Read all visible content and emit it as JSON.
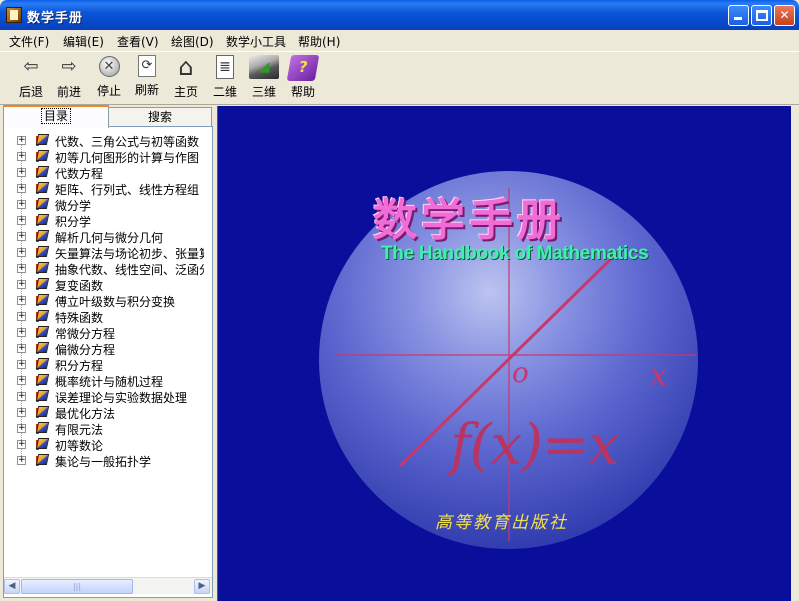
{
  "window": {
    "title": "数学手册",
    "buttons": {
      "minimize": "_",
      "maximize": "□",
      "close": "✕"
    }
  },
  "menu": [
    "文件(F)",
    "编辑(E)",
    "查看(V)",
    "绘图(D)",
    "数学小工具",
    "帮助(H)"
  ],
  "toolbar": [
    {
      "label": "后退",
      "icon": "arrow-left-icon",
      "glyph": "⇦"
    },
    {
      "label": "前进",
      "icon": "arrow-right-icon",
      "glyph": "⇨"
    },
    {
      "label": "停止",
      "icon": "stop-icon",
      "glyph": "✕"
    },
    {
      "label": "刷新",
      "icon": "refresh-icon",
      "glyph": "⟳"
    },
    {
      "label": "主页",
      "icon": "home-icon",
      "glyph": "⌂"
    },
    {
      "label": "二维",
      "icon": "2d-plot-icon",
      "glyph": "≣"
    },
    {
      "label": "三维",
      "icon": "3d-plot-icon",
      "glyph": "◢"
    },
    {
      "label": "帮助",
      "icon": "help-book-icon",
      "glyph": "?"
    }
  ],
  "tabs": [
    "目录",
    "搜索"
  ],
  "tree": [
    "代数、三角公式与初等函数",
    "初等几何图形的计算与作图",
    "代数方程",
    "矩阵、行列式、线性方程组",
    "微分学",
    "积分学",
    "解析几何与微分几何",
    "矢量算法与场论初步、张量算法",
    "抽象代数、线性空间、泛函分析",
    "复变函数",
    "傅立叶级数与积分变换",
    "特殊函数",
    "常微分方程",
    "偏微分方程",
    "积分方程",
    "概率统计与随机过程",
    "误差理论与实验数据处理",
    "最优化方法",
    "有限元法",
    "初等数论",
    "集论与一般拓扑学"
  ],
  "splash": {
    "title": "数学手册",
    "subtitle": "The Handbook of Mathematics",
    "origin": "o",
    "axis_x": "x",
    "formula": "f(x)=x",
    "publisher": "高等教育出版社",
    "colors": {
      "background": "#0a0f9b",
      "title": "#f06cd6",
      "subtitle": "#40f0b0",
      "math": "#c8386c",
      "publisher": "#f0e050"
    }
  }
}
